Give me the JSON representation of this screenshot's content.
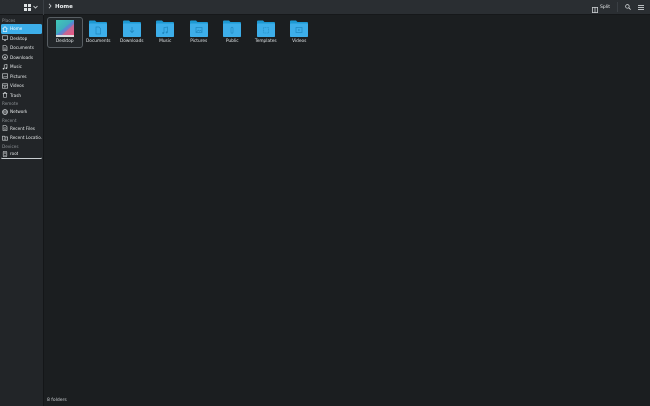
{
  "toolbar": {
    "breadcrumb_label": "Home",
    "split_label": "Split",
    "icons": {
      "view_mode": "icon-view-grid-icon",
      "split": "split-view-icon",
      "search": "search-icon",
      "menu": "hamburger-menu-icon"
    }
  },
  "sidebar": {
    "sections": [
      {
        "title": "Places",
        "items": [
          {
            "label": "Home",
            "icon": "home-icon",
            "active": true
          },
          {
            "label": "Desktop",
            "icon": "desktop-icon"
          },
          {
            "label": "Documents",
            "icon": "documents-icon"
          },
          {
            "label": "Downloads",
            "icon": "downloads-icon"
          },
          {
            "label": "Music",
            "icon": "music-icon"
          },
          {
            "label": "Pictures",
            "icon": "pictures-icon"
          },
          {
            "label": "Videos",
            "icon": "videos-icon"
          },
          {
            "label": "Trash",
            "icon": "trash-icon"
          }
        ]
      },
      {
        "title": "Remote",
        "items": [
          {
            "label": "Network",
            "icon": "network-icon"
          }
        ]
      },
      {
        "title": "Recent",
        "items": [
          {
            "label": "Recent Files",
            "icon": "recent-files-icon"
          },
          {
            "label": "Recent Locatio...",
            "icon": "recent-locations-icon"
          }
        ]
      },
      {
        "title": "Devices",
        "items": [
          {
            "label": "root",
            "icon": "drive-icon"
          }
        ]
      }
    ]
  },
  "files": [
    {
      "name": "Desktop",
      "icon": "desktop-folder-icon",
      "selected": true
    },
    {
      "name": "Documents",
      "icon": "documents-folder-icon"
    },
    {
      "name": "Downloads",
      "icon": "downloads-folder-icon"
    },
    {
      "name": "Music",
      "icon": "music-folder-icon"
    },
    {
      "name": "Pictures",
      "icon": "pictures-folder-icon"
    },
    {
      "name": "Public",
      "icon": "public-folder-icon"
    },
    {
      "name": "Templates",
      "icon": "templates-folder-icon"
    },
    {
      "name": "Videos",
      "icon": "videos-folder-icon"
    }
  ],
  "status": {
    "text": "8 folders"
  },
  "colors": {
    "accent": "#3daee9",
    "folder": "#3daee9",
    "folder_dark": "#1d99d3",
    "background": "#1b1e20",
    "sidebar": "#222528",
    "toolbar": "#2a2e32"
  }
}
